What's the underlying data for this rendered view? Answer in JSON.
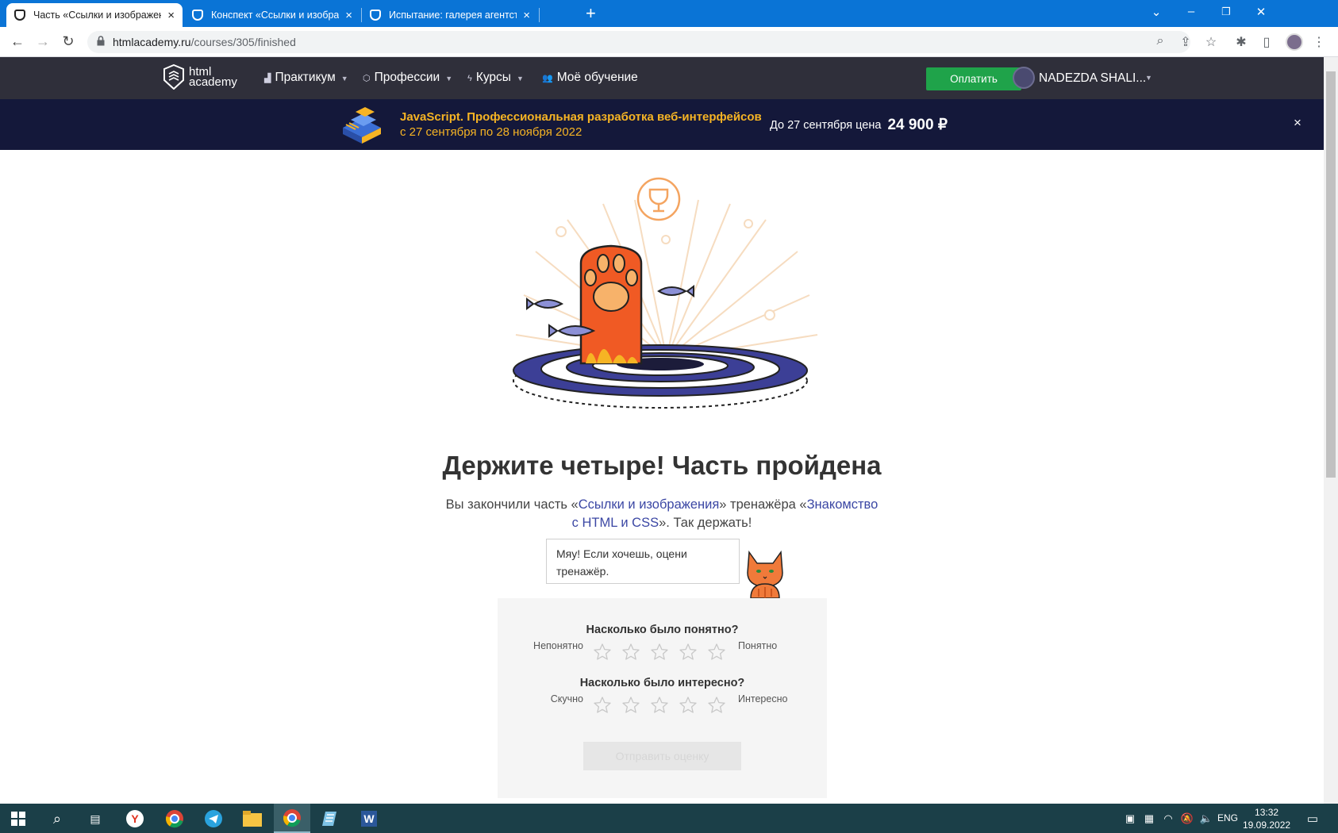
{
  "browser": {
    "tabs": [
      {
        "title": "Часть «Ссылки и изображения» ",
        "active": true
      },
      {
        "title": "Конспект «Ссылки и изображения» ",
        "active": false
      },
      {
        "title": "Испытание: галерея агентства «",
        "active": false
      }
    ],
    "url_host": "htmlacademy.ru",
    "url_path": "/courses/305/finished"
  },
  "site": {
    "logo_line1": "html",
    "logo_line2": "academy",
    "menu": [
      {
        "label": "Практикум",
        "icon": "chart-icon"
      },
      {
        "label": "Профессии",
        "icon": "cap-icon"
      },
      {
        "label": "Курсы",
        "icon": "bolt-icon"
      },
      {
        "label": "Моё обучение",
        "icon": "people-icon"
      }
    ],
    "pay_label": "Оплатить",
    "user_name": "NADEZDA SHALI..."
  },
  "banner": {
    "title": "JavaScript. Профессиональная разработка веб-интерфейсов",
    "dates": "с 27 сентября по 28 ноября 2022",
    "price_prefix": "До 27 сентября цена",
    "price": "24 900 ₽",
    "close_label": "×"
  },
  "content": {
    "heading": "Держите четыре! Часть пройдена",
    "sub_before": "Вы закончили часть «",
    "sub_link1": "Ссылки и изображения",
    "sub_middle": "» тренажёра «",
    "sub_link2": "Знакомство с HTML и CSS",
    "sub_after": "». Так держать!",
    "bubble": "Мяу! Если хочешь, оцени тренажёр."
  },
  "rating": {
    "q1": "Насколько было понятно?",
    "q1_low": "Непонятно",
    "q1_high": "Понятно",
    "q2": "Насколько было интересно?",
    "q2_low": "Скучно",
    "q2_high": "Интересно",
    "stars_count": 5,
    "submit_label": "Отправить оценку"
  },
  "taskbar": {
    "lang": "ENG",
    "time": "13:32",
    "date": "19.09.2022"
  },
  "colors": {
    "tabbar": "#0a74d6",
    "site_header": "#2f2f3a",
    "banner_bg": "#14183a",
    "banner_accent": "#f6b424",
    "pay_button": "#1fa34a",
    "link": "#3b47a4",
    "paw": "#f05a24",
    "taskbar": "#1b3f48"
  }
}
